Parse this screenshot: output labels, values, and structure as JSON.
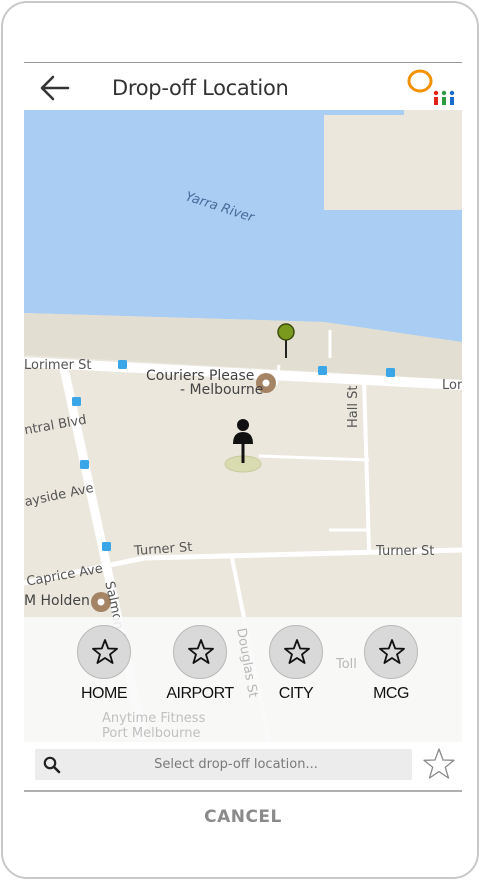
{
  "header": {
    "title": "Drop-off Location",
    "back_icon": "arrow-left-icon",
    "logo_colors": {
      "ring": "#f39200",
      "dot1": "#e2231a",
      "dot2": "#2e9b3f",
      "dot3": "#1a6cc8"
    }
  },
  "map": {
    "water_color": "#a9cdf3",
    "land_color": "#ebe7dd",
    "road_color": "#ffffff",
    "labels": {
      "river": "Yarra River",
      "lorimer": "Lorimer St",
      "lorimer_right": "Lor",
      "couriers_line1": "Couriers Please",
      "couriers_line2": "- Melbourne",
      "hall": "Hall St",
      "central": "ntral Blvd",
      "bayside": "ayside Ave",
      "turner_left": "Turner St",
      "turner_right": "Turner St",
      "caprice": "Caprice Ave",
      "holden": "M Holden",
      "salmon": "Salmon St",
      "douglas": "Douglas St",
      "toll": "Toll",
      "anytime1": "Anytime Fitness",
      "anytime2": "Port Melbourne"
    },
    "pin_color": "#7a9a1e",
    "marker_icon": "person-pin-icon"
  },
  "shortcuts": [
    {
      "label": "HOME",
      "icon": "star-icon"
    },
    {
      "label": "AIRPORT",
      "icon": "star-icon"
    },
    {
      "label": "CITY",
      "icon": "star-icon"
    },
    {
      "label": "MCG",
      "icon": "star-icon"
    }
  ],
  "search": {
    "placeholder": "Select drop-off location...",
    "icon": "search-icon",
    "favorite_icon": "star-outline-icon"
  },
  "footer": {
    "cancel_label": "CANCEL"
  }
}
